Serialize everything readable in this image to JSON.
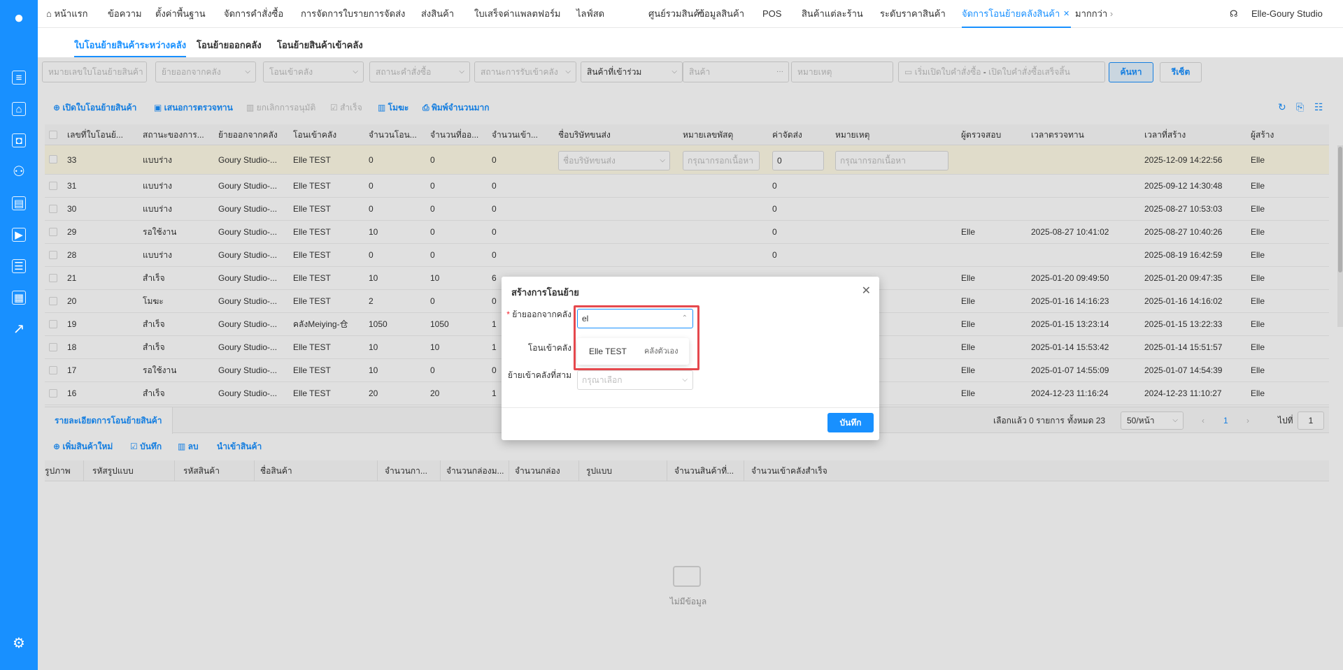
{
  "sidebar": {
    "icons": [
      "logo-icon",
      "document-icon",
      "home-icon",
      "bag-icon",
      "user-icon",
      "store-icon",
      "video-icon",
      "list-icon",
      "shop-icon",
      "chart-icon",
      "gear-icon"
    ]
  },
  "topbar": {
    "home": "หน้าแรก",
    "tabs": [
      "ข้อความ",
      "ตั้งค่าพื้นฐาน",
      "จัดการคำสั่งซื้อ",
      "การจัดการใบรายการจัดส่ง",
      "ส่งสินค้า",
      "ใบเสร็จค่าแพลตฟอร์ม",
      "ไลฟ์สด",
      "ศูนย์รวมสินค้า",
      "ข้อมูลสินค้า",
      "POS",
      "สินค้าแต่ละร้าน",
      "ระดับราคาสินค้า"
    ],
    "active_tab": "จัดการโอนย้ายคลังสินค้า",
    "more": "มากกว่า",
    "user": "Elle-Goury Studio"
  },
  "subtabs": [
    "ใบโอนย้ายสินค้าระหว่างคลัง",
    "โอนย้ายออกคลัง",
    "โอนย้ายสินค้าเข้าคลัง"
  ],
  "filters": {
    "transfer_no": "หมายเลขใบโอนย้ายสินค้า",
    "from_wh": "ย้ายออกจากคลัง",
    "to_wh": "โอนเข้าคลัง",
    "order_status": "สถานะคำสั่งซื้อ",
    "receive_status": "สถานะการรับเข้าคลัง",
    "product_scope": "สินค้าที่เข้าร่วม",
    "product": "สินค้า",
    "note": "หมายเหตุ",
    "date_start": "เริ่มเปิดใบคำสั่งซื้อ",
    "date_sep": "-",
    "date_end": "เปิดใบคำสั่งซื้อเสร็จสิ้น",
    "search": "ค้นหา",
    "reset": "รีเซ็ต"
  },
  "toolbar": {
    "open": "เปิดใบโอนย้ายสินค้า",
    "propose": "เสนอการตรวจทาน",
    "cancel_approve": "ยกเลิกการอนุมัติ",
    "done": "สำเร็จ",
    "void": "โมฆะ",
    "bulk_print": "พิมพ์จำนวนมาก"
  },
  "table": {
    "headers": [
      "เลขที่ใบโอนย้...",
      "สถานะของการ...",
      "ย้ายออกจากคลัง",
      "โอนเข้าคลัง",
      "จำนวนโอน...",
      "จำนวนที่ออ...",
      "จำนวนเข้า...",
      "ชื่อบริษัทขนส่ง",
      "หมายเลขพัสดุ",
      "ค่าจัดส่ง",
      "หมายเหตุ",
      "ผู้ตรวจสอบ",
      "เวลาตรวจทาน",
      "เวลาที่สร้าง",
      "ผู้สร้าง"
    ],
    "first_row": {
      "id": "33",
      "status": "แบบร่าง",
      "from": "Goury Studio-...",
      "to": "Elle TEST",
      "q1": "0",
      "q2": "0",
      "q3": "0",
      "carrier_ph": "ชื่อบริษัทขนส่ง",
      "tracking_ph": "กรุณากรอกเนื้อหา",
      "fee": "0",
      "note_ph": "กรุณากรอกเนื้อหา",
      "created": "2025-12-09 14:22:56",
      "creator": "Elle"
    },
    "rows": [
      {
        "id": "31",
        "status": "แบบร่าง",
        "from": "Goury Studio-...",
        "to": "Elle TEST",
        "q1": "0",
        "q2": "0",
        "q3": "0",
        "fee": "0",
        "reviewer": "",
        "reviewed": "",
        "created": "2025-09-12 14:30:48",
        "creator": "Elle"
      },
      {
        "id": "30",
        "status": "แบบร่าง",
        "from": "Goury Studio-...",
        "to": "Elle TEST",
        "q1": "0",
        "q2": "0",
        "q3": "0",
        "fee": "0",
        "reviewer": "",
        "reviewed": "",
        "created": "2025-08-27 10:53:03",
        "creator": "Elle"
      },
      {
        "id": "29",
        "status": "รอใช้งาน",
        "from": "Goury Studio-...",
        "to": "Elle TEST",
        "q1": "10",
        "q2": "0",
        "q3": "0",
        "fee": "0",
        "reviewer": "Elle",
        "reviewed": "2025-08-27 10:41:02",
        "created": "2025-08-27 10:40:26",
        "creator": "Elle"
      },
      {
        "id": "28",
        "status": "แบบร่าง",
        "from": "Goury Studio-...",
        "to": "Elle TEST",
        "q1": "0",
        "q2": "0",
        "q3": "0",
        "fee": "0",
        "reviewer": "",
        "reviewed": "",
        "created": "2025-08-19 16:42:59",
        "creator": "Elle"
      },
      {
        "id": "21",
        "status": "สำเร็จ",
        "from": "Goury Studio-...",
        "to": "Elle TEST",
        "q1": "10",
        "q2": "10",
        "q3": "6",
        "fee": "",
        "reviewer": "Elle",
        "reviewed": "2025-01-20 09:49:50",
        "created": "2025-01-20 09:47:35",
        "creator": "Elle"
      },
      {
        "id": "20",
        "status": "โมฆะ",
        "from": "Goury Studio-...",
        "to": "Elle TEST",
        "q1": "2",
        "q2": "0",
        "q3": "0",
        "fee": "",
        "reviewer": "Elle",
        "reviewed": "2025-01-16 14:16:23",
        "created": "2025-01-16 14:16:02",
        "creator": "Elle"
      },
      {
        "id": "19",
        "status": "สำเร็จ",
        "from": "Goury Studio-...",
        "to": "คลังMeiying-仓",
        "q1": "1050",
        "q2": "1050",
        "q3": "1",
        "fee": "",
        "reviewer": "Elle",
        "reviewed": "2025-01-15 13:23:14",
        "created": "2025-01-15 13:22:33",
        "creator": "Elle"
      },
      {
        "id": "18",
        "status": "สำเร็จ",
        "from": "Goury Studio-...",
        "to": "Elle TEST",
        "q1": "10",
        "q2": "10",
        "q3": "1",
        "fee": "",
        "reviewer": "Elle",
        "reviewed": "2025-01-14 15:53:42",
        "created": "2025-01-14 15:51:57",
        "creator": "Elle"
      },
      {
        "id": "17",
        "status": "รอใช้งาน",
        "from": "Goury Studio-...",
        "to": "Elle TEST",
        "q1": "10",
        "q2": "0",
        "q3": "0",
        "fee": "",
        "reviewer": "Elle",
        "reviewed": "2025-01-07 14:55:09",
        "created": "2025-01-07 14:54:39",
        "creator": "Elle"
      },
      {
        "id": "16",
        "status": "สำเร็จ",
        "from": "Goury Studio-...",
        "to": "Elle TEST",
        "q1": "20",
        "q2": "20",
        "q3": "1",
        "fee": "",
        "reviewer": "Elle",
        "reviewed": "2024-12-23 11:16:24",
        "created": "2024-12-23 11:10:27",
        "creator": "Elle"
      }
    ]
  },
  "detail": {
    "tab": "รายละเอียดการโอนย้ายสินค้า",
    "selected": "เลือกแล้ว 0 รายการ",
    "total": "ทั้งหมด 23",
    "page_size": "50/หน้า",
    "page": "1",
    "goto": "ไปที่",
    "goto_value": "1",
    "actions": [
      "เพิ่มสินค้าใหม่",
      "บันทึก",
      "ลบ",
      "นำเข้าสินค้า"
    ],
    "headers": [
      "รูปภาพ",
      "รหัสรูปแบบ",
      "รหัสสินค้า",
      "ชื่อสินค้า",
      "จำนวนกา...",
      "จำนวนกล่องม...",
      "จำนวนกล่อง",
      "รูปแบบ",
      "จำนวนสินค้าที่...",
      "จำนวนเข้าคลังสำเร็จ"
    ],
    "empty": "ไม่มีข้อมูล"
  },
  "modal": {
    "title": "สร้างการโอนย้าย",
    "from_label": "ย้ายออกจากคลัง",
    "from_value": "el",
    "to_label": "โอนเข้าคลัง",
    "third_label": "ย้ายเข้าคลังที่สาม",
    "third_placeholder": "กรุณาเลือก",
    "option_name": "Elle TEST",
    "option_tag": "คลังตัวเอง",
    "save": "บันทึก"
  }
}
